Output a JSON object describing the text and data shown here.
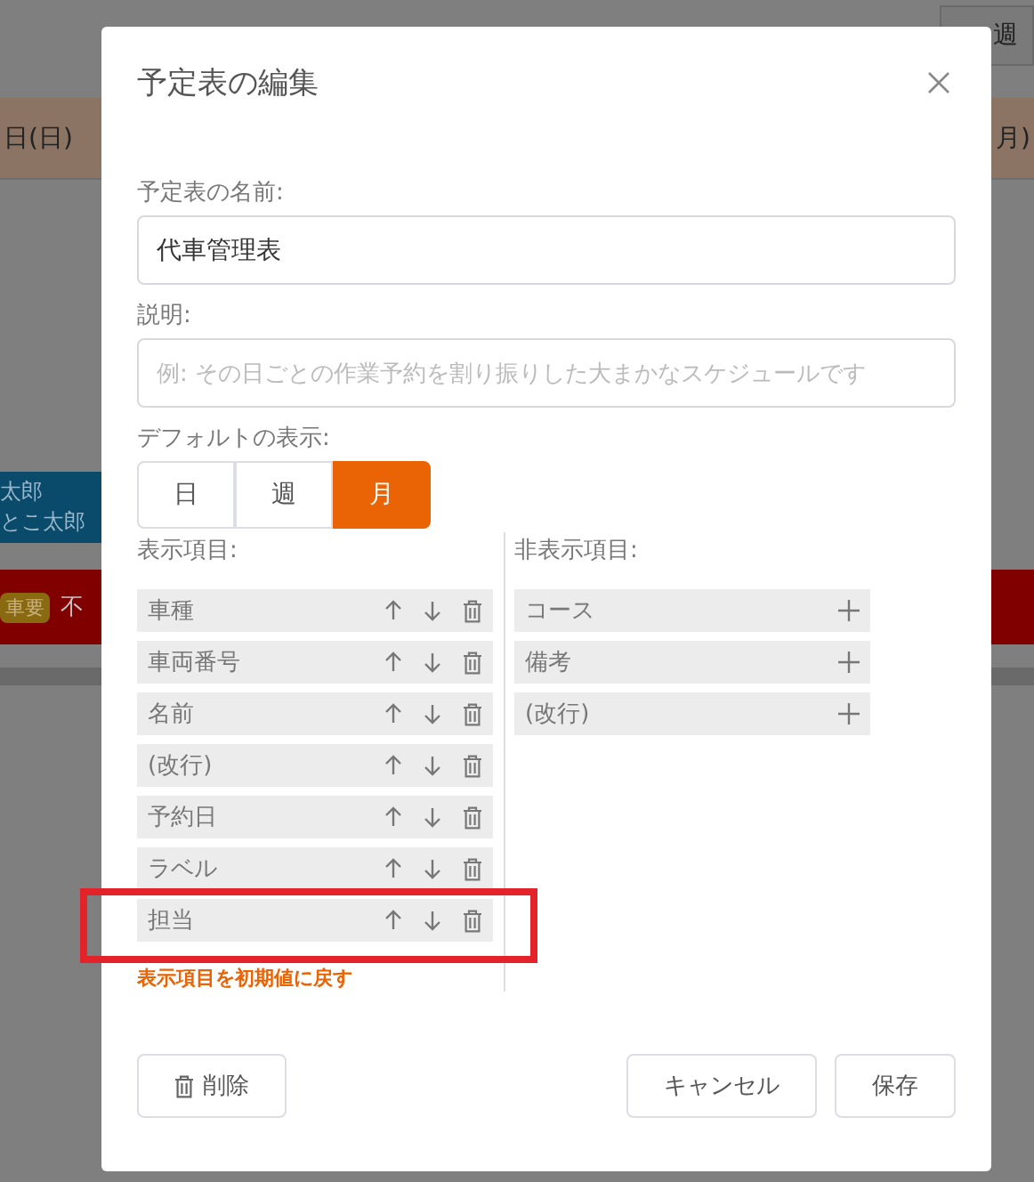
{
  "background": {
    "view_buttons": [
      "週"
    ],
    "day_headers": [
      "日(日)",
      "月)"
    ],
    "event_lines": [
      "太郎",
      "とこ太郎"
    ],
    "red_bar": {
      "badge": "車要",
      "text": "不"
    }
  },
  "dialog": {
    "title": "予定表の編集",
    "name_field": {
      "label": "予定表の名前:",
      "value": "代車管理表"
    },
    "description_field": {
      "label": "説明:",
      "placeholder": "例: その日ごとの作業予約を割り振りした大まかなスケジュールです"
    },
    "default_view": {
      "label": "デフォルトの表示:",
      "options": [
        {
          "label": "日",
          "selected": false
        },
        {
          "label": "週",
          "selected": false
        },
        {
          "label": "月",
          "selected": true
        }
      ]
    },
    "shown_items": {
      "label": "表示項目:",
      "items": [
        {
          "label": "車種",
          "highlighted": false
        },
        {
          "label": "車両番号",
          "highlighted": false
        },
        {
          "label": "名前",
          "highlighted": false
        },
        {
          "label": "(改行)",
          "highlighted": false
        },
        {
          "label": "予約日",
          "highlighted": false
        },
        {
          "label": "ラベル",
          "highlighted": false
        },
        {
          "label": "担当",
          "highlighted": true
        }
      ]
    },
    "hidden_items": {
      "label": "非表示項目:",
      "items": [
        {
          "label": "コース"
        },
        {
          "label": "備考"
        },
        {
          "label": "(改行)"
        }
      ]
    },
    "reset_link": "表示項目を初期値に戻す",
    "delete_button": "削除",
    "cancel_button": "キャンセル",
    "save_button": "保存"
  }
}
